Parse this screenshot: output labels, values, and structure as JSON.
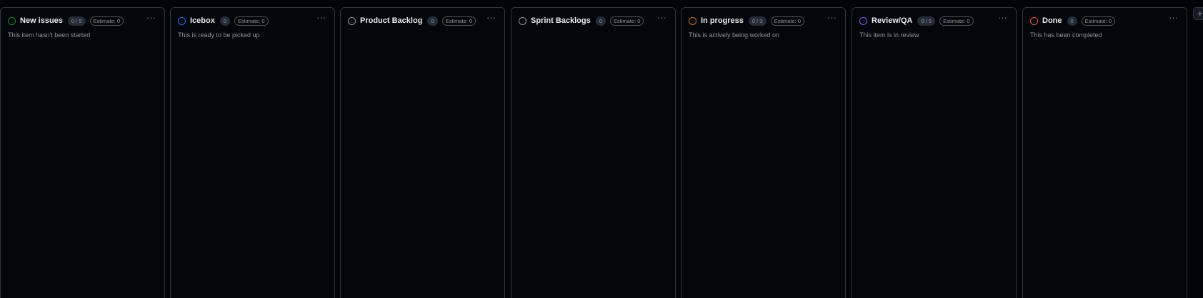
{
  "columns": [
    {
      "title": "New issues",
      "count": "0 / 5",
      "estimate": "Estimate: 0",
      "description": "This item hasn't been started",
      "color": "#238636"
    },
    {
      "title": "Icebox",
      "count": "0",
      "estimate": "Estimate: 0",
      "description": "This is ready to be picked up",
      "color": "#1f6feb"
    },
    {
      "title": "Product Backlog",
      "count": "0",
      "estimate": "Estimate: 0",
      "description": "",
      "color": "#8d96a0"
    },
    {
      "title": "Sprint Backlogs",
      "count": "0",
      "estimate": "Estimate: 0",
      "description": "",
      "color": "#8d96a0"
    },
    {
      "title": "In progress",
      "count": "0 / 3",
      "estimate": "Estimate: 0",
      "description": "This is actively being worked on",
      "color": "#c0741a"
    },
    {
      "title": "Review/QA",
      "count": "0 / 5",
      "estimate": "Estimate: 0",
      "description": "This item is in review",
      "color": "#8957e5"
    },
    {
      "title": "Done",
      "count": "0",
      "estimate": "Estimate: 0",
      "description": "This has been completed",
      "color": "#e5534b"
    }
  ],
  "more_label": "···",
  "add_column_label": "+"
}
